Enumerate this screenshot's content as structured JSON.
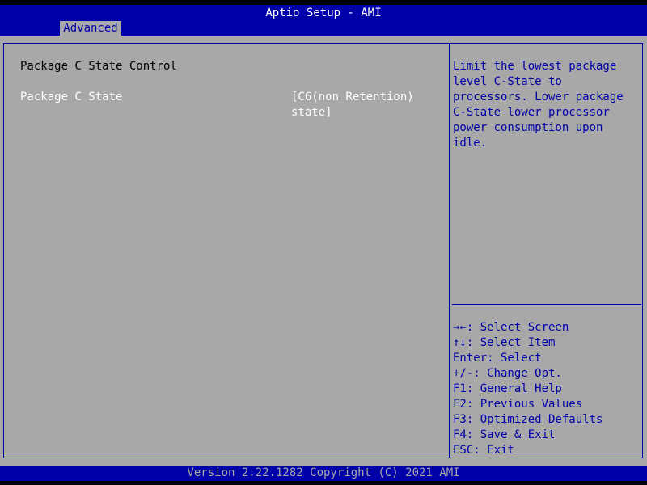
{
  "header": {
    "title": "Aptio Setup - AMI",
    "active_tab": "Advanced"
  },
  "main": {
    "section_title": "Package C State Control",
    "settings": [
      {
        "label": "Package C State",
        "value": "[C6(non Retention)\nstate]"
      }
    ]
  },
  "help": {
    "description": "Limit the lowest package\nlevel C-State to\nprocessors. Lower package\nC-State lower processor\npower consumption upon idle.",
    "keys": [
      "→←: Select Screen",
      "↑↓: Select Item",
      "Enter: Select",
      "+/-: Change Opt.",
      "F1: General Help",
      "F2: Previous Values",
      "F3: Optimized Defaults",
      "F4: Save & Exit",
      "ESC: Exit"
    ]
  },
  "footer": {
    "text": "Version 2.22.1282 Copyright (C) 2021 AMI"
  },
  "colors": {
    "bios_blue": "#0000a8",
    "bios_gray": "#a8a8a8",
    "text_white": "#ffffff",
    "text_black": "#000000"
  }
}
